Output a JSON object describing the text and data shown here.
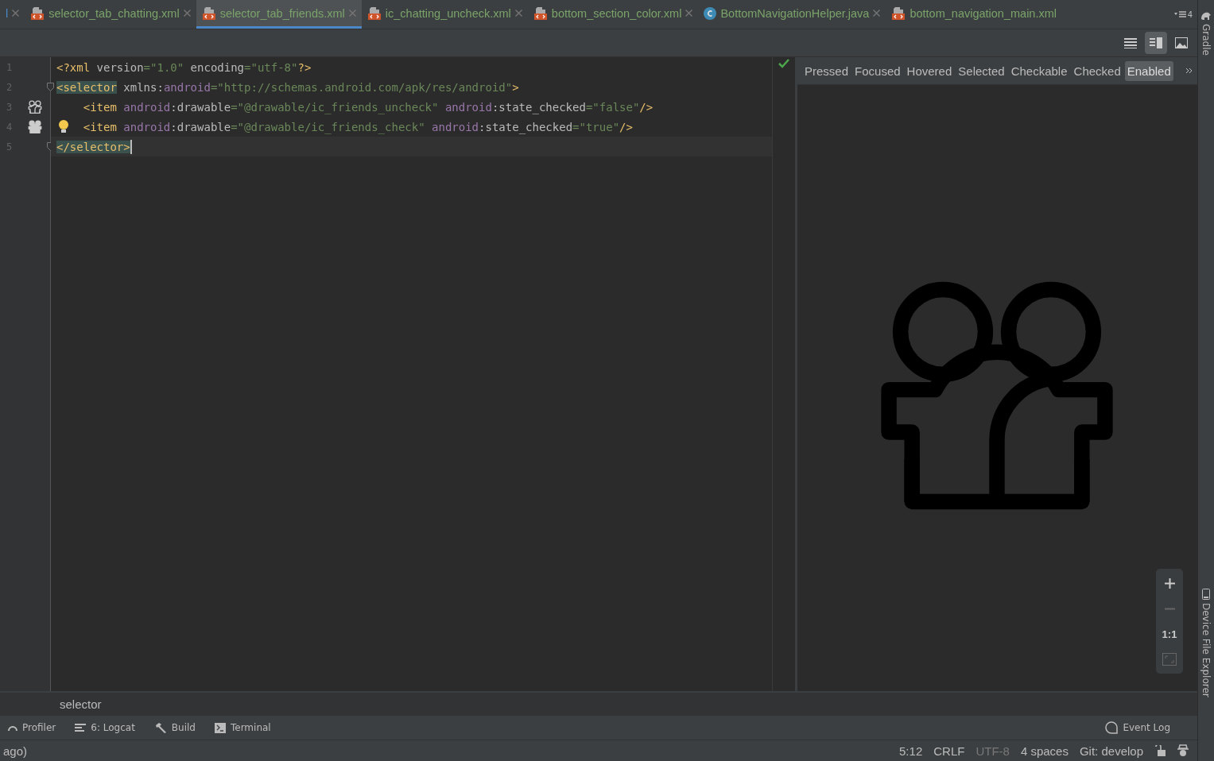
{
  "tabs": [
    {
      "label": "l",
      "kind": "cut",
      "selected": false
    },
    {
      "label": "selector_tab_chatting.xml",
      "kind": "xml",
      "selected": false
    },
    {
      "label": "selector_tab_friends.xml",
      "kind": "xml",
      "selected": true
    },
    {
      "label": "ic_chatting_uncheck.xml",
      "kind": "xml",
      "selected": false
    },
    {
      "label": "bottom_section_color.xml",
      "kind": "xml",
      "selected": false
    },
    {
      "label": "BottomNavigationHelper.java",
      "kind": "java",
      "selected": false
    },
    {
      "label": "bottom_navigation_main.xml",
      "kind": "xml",
      "selected": false,
      "closable": false
    }
  ],
  "tab_overflow_count": "4",
  "view_modes": [
    {
      "kind": "code",
      "selected": false
    },
    {
      "kind": "split",
      "selected": true
    },
    {
      "kind": "design",
      "selected": false
    }
  ],
  "editor": {
    "lines": [
      {
        "number": "1",
        "kind": "plain",
        "fold": false,
        "current": false,
        "tokens": [
          {
            "kind": "tag",
            "text": "<?xml "
          },
          {
            "kind": "attr",
            "text": "version"
          },
          {
            "kind": "value",
            "text": "=\"1.0\" "
          },
          {
            "kind": "attr",
            "text": "encoding"
          },
          {
            "kind": "value",
            "text": "=\"utf-8\""
          },
          {
            "kind": "tag",
            "text": "?>"
          }
        ]
      },
      {
        "number": "2",
        "kind": "plain",
        "fold": true,
        "current": false,
        "tokens": [
          {
            "kind": "tag",
            "text": "<selector",
            "highlighted": true
          },
          {
            "kind": "attr",
            "text": " xmlns:"
          },
          {
            "kind": "ns",
            "text": "android"
          },
          {
            "kind": "value",
            "text": "=\"http://schemas.android.com/apk/res/android\""
          },
          {
            "kind": "tag",
            "text": ">"
          }
        ]
      },
      {
        "number": "3",
        "kind": "outline-icon",
        "fold": false,
        "current": false,
        "tokens": [
          {
            "kind": "tag",
            "text": "    <item "
          },
          {
            "kind": "ns",
            "text": "android"
          },
          {
            "kind": "attr",
            "text": ":drawable"
          },
          {
            "kind": "value",
            "text": "=\"@drawable/ic_friends_uncheck\" "
          },
          {
            "kind": "ns",
            "text": "android"
          },
          {
            "kind": "attr",
            "text": ":state_checked"
          },
          {
            "kind": "value",
            "text": "=\"false\""
          },
          {
            "kind": "tag",
            "text": "/>"
          }
        ]
      },
      {
        "number": "4",
        "kind": "filled-icon",
        "fold": false,
        "current": false,
        "bulb": true,
        "tokens": [
          {
            "kind": "tag",
            "text": "    <item "
          },
          {
            "kind": "ns",
            "text": "android"
          },
          {
            "kind": "attr",
            "text": ":drawable"
          },
          {
            "kind": "value",
            "text": "=\"@drawable/ic_friends_check\" "
          },
          {
            "kind": "ns",
            "text": "android"
          },
          {
            "kind": "attr",
            "text": ":state_checked"
          },
          {
            "kind": "value",
            "text": "=\"true\""
          },
          {
            "kind": "tag",
            "text": "/>"
          }
        ]
      },
      {
        "number": "5",
        "kind": "plain",
        "fold": true,
        "current": true,
        "tokens": [
          {
            "kind": "tag",
            "text": "</selector>",
            "highlighted": true
          }
        ]
      }
    ]
  },
  "preview": {
    "states": [
      {
        "label": "Pressed",
        "selected": false
      },
      {
        "label": "Focused",
        "selected": false
      },
      {
        "label": "Hovered",
        "selected": false
      },
      {
        "label": "Selected",
        "selected": false
      },
      {
        "label": "Checkable",
        "selected": false
      },
      {
        "label": "Checked",
        "selected": false
      },
      {
        "label": "Enabled",
        "selected": true
      }
    ],
    "zoom_controls": [
      {
        "kind": "plus",
        "disabled": false
      },
      {
        "kind": "minus",
        "disabled": true
      },
      {
        "kind": "actual",
        "text": "1:1",
        "disabled": false
      },
      {
        "kind": "fit",
        "disabled": true
      }
    ]
  },
  "side_tools": [
    {
      "label": "Gradle",
      "kind": "gradle"
    },
    {
      "label": "Device File Explorer",
      "kind": "device"
    }
  ],
  "breadcrumb": "selector",
  "tool_windows": [
    {
      "label": "Profiler",
      "kind": "profiler"
    },
    {
      "label": "6: Logcat",
      "kind": "logcat"
    },
    {
      "label": "Build",
      "kind": "build"
    },
    {
      "label": "Terminal",
      "kind": "terminal"
    }
  ],
  "event_log": "Event Log",
  "status_bar": {
    "message": "ago)",
    "items": [
      {
        "text": "5:12",
        "disabled": false
      },
      {
        "text": "CRLF",
        "disabled": false
      },
      {
        "text": "UTF-8",
        "disabled": true
      },
      {
        "text": "4 spaces",
        "disabled": false
      },
      {
        "text": "Git: develop",
        "disabled": false
      }
    ]
  }
}
